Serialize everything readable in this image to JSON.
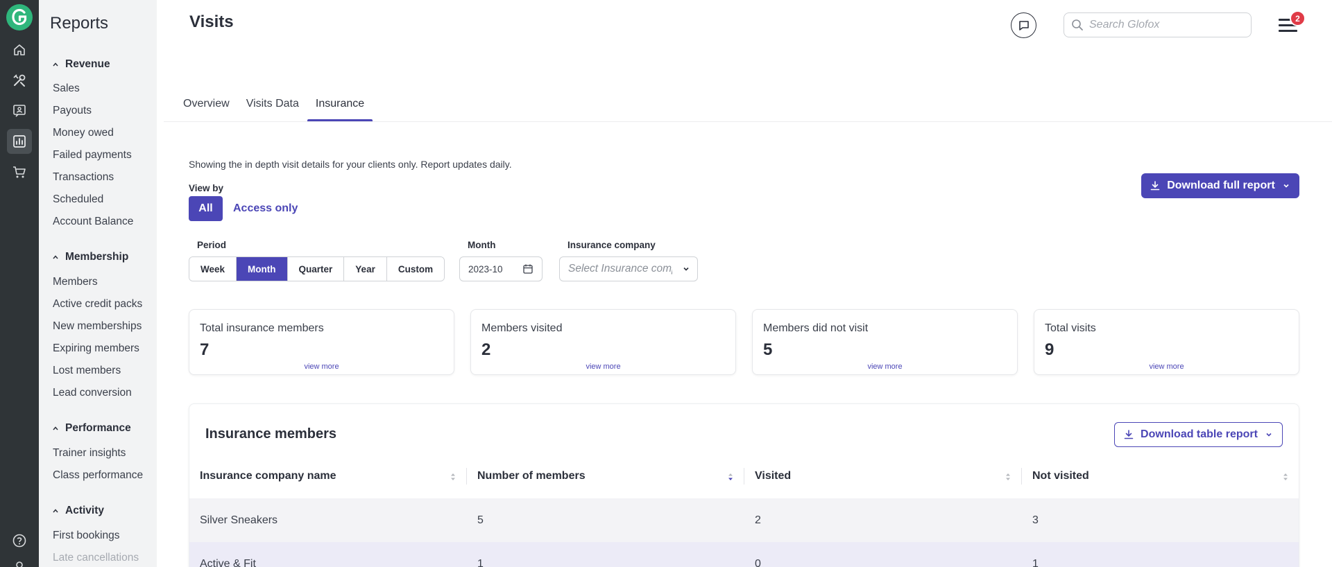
{
  "sidebar": {
    "title": "Reports",
    "sections": [
      {
        "label": "Revenue",
        "items": [
          "Sales",
          "Payouts",
          "Money owed",
          "Failed payments",
          "Transactions",
          "Scheduled",
          "Account Balance"
        ]
      },
      {
        "label": "Membership",
        "items": [
          "Members",
          "Active credit packs",
          "New memberships",
          "Expiring members",
          "Lost members",
          "Lead conversion"
        ]
      },
      {
        "label": "Performance",
        "items": [
          "Trainer insights",
          "Class performance"
        ]
      },
      {
        "label": "Activity",
        "items": [
          "First bookings",
          "Late cancellations"
        ]
      }
    ]
  },
  "header": {
    "title": "Visits",
    "search_placeholder": "Search Glofox",
    "notification_count": "2"
  },
  "tabs": [
    {
      "label": "Overview",
      "active": false
    },
    {
      "label": "Visits Data",
      "active": false
    },
    {
      "label": "Insurance",
      "active": true
    }
  ],
  "description": "Showing the in depth visit details for your clients only. Report updates daily.",
  "view_by": {
    "label": "View by",
    "options": [
      "All",
      "Access only"
    ],
    "selected": "All"
  },
  "download_full_label": "Download full report",
  "filters": {
    "period_label": "Period",
    "period_options": [
      "Week",
      "Month",
      "Quarter",
      "Year",
      "Custom"
    ],
    "period_selected": "Month",
    "month_label": "Month",
    "month_value": "2023-10",
    "insurance_label": "Insurance company",
    "insurance_placeholder": "Select Insurance company"
  },
  "cards": [
    {
      "title": "Total insurance members",
      "value": "7",
      "more": "view more"
    },
    {
      "title": "Members visited",
      "value": "2",
      "more": "view more"
    },
    {
      "title": "Members did not visit",
      "value": "5",
      "more": "view more"
    },
    {
      "title": "Total visits",
      "value": "9",
      "more": "view more"
    }
  ],
  "table": {
    "title": "Insurance members",
    "download_label": "Download table report",
    "columns": [
      "Insurance company name",
      "Number of members",
      "Visited",
      "Not visited"
    ],
    "rows": [
      [
        "Silver Sneakers",
        "5",
        "2",
        "3"
      ],
      [
        "Active & Fit",
        "1",
        "0",
        "1"
      ]
    ]
  },
  "colors": {
    "accent": "#4b46b6",
    "rail": "#2f3437",
    "brand": "#2fb67c",
    "badge": "#e03b47"
  }
}
